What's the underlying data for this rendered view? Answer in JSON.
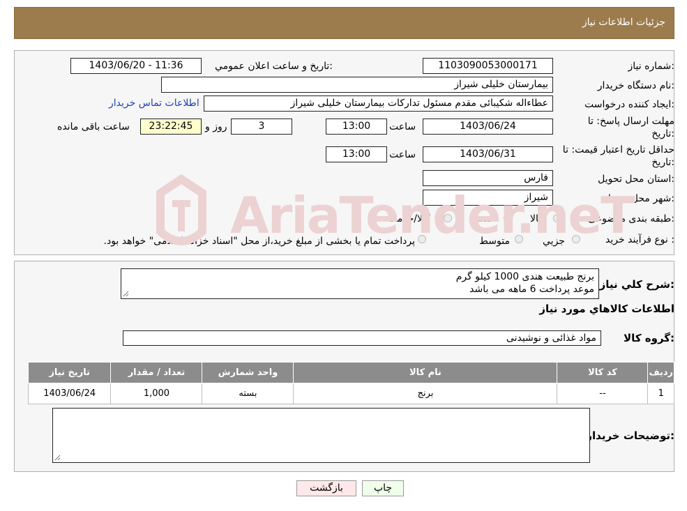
{
  "header": {
    "title": "جزئیات اطلاعات نیاز"
  },
  "form": {
    "need_number_label": "شماره نیاز:",
    "need_number": "1103090053000171",
    "announce_label": "تاریخ و ساعت اعلان عمومي:",
    "announce_value": "1403/06/20 - 11:36",
    "buyer_org_label": "نام دستگاه خریدار:",
    "buyer_org": "بیمارستان خلیلی شیراز",
    "creator_label": "ایجاد کننده درخواست:",
    "creator": "عطاءاله شکیبائی مقدم مسئول تدارکات  بیمارستان خلیلی شیراز",
    "contact_link": "اطلاعات تماس خریدار",
    "deadline_label_1": "مهلت ارسال پاسخ: تا",
    "deadline_label_2": "تاریخ:",
    "deadline_date": "1403/06/24",
    "time_label": "ساعت",
    "deadline_time": "13:00",
    "days": "3",
    "days_label": "روز و",
    "remaining": "23:22:45",
    "remaining_label": "ساعت باقی مانده",
    "validity_label_1": "حداقل تاریخ اعتبار قیمت: تا",
    "validity_label_2": "تاریخ:",
    "validity_date": "1403/06/31",
    "validity_time": "13:00",
    "province_label": "استان محل تحویل:",
    "province": "فارس",
    "city_label": "شهر محل تحویل:",
    "city": "شیراز",
    "category_label": "طبقه بندی موضوعی:",
    "category_options": [
      "کالا",
      "خدمت",
      "کالا/خدمت"
    ],
    "process_label": "نوع فرآیند خرید :",
    "process_options": [
      "جزیي",
      "متوسط"
    ],
    "process_note": "پرداخت تمام یا بخشی از مبلغ خرید،از محل \"اسناد خزانه اسلامی\" خواهد بود."
  },
  "description": {
    "label": "شرح کلي نياز:",
    "line1": "برنج طبیعت هندی  1000 کیلو گرم",
    "line2": "موعد پرداخت 6 ماهه می باشد"
  },
  "goods": {
    "section_title": "اطلاعات کالاهاي مورد نياز",
    "group_label": "گروه کالا:",
    "group_value": "مواد غذائی و نوشیدنی",
    "columns": [
      "رديف",
      "کد کالا",
      "نام کالا",
      "واحد شمارش",
      "تعداد / مقدار",
      "تاريخ نياز"
    ],
    "rows": [
      [
        "1",
        "--",
        "برنج",
        "بسته",
        "1,000",
        "1403/06/24"
      ]
    ]
  },
  "buyer_notes": {
    "label": "توضیحات خریدار:"
  },
  "buttons": {
    "print": "چاپ",
    "back": "بازگشت"
  },
  "watermark": {
    "text": "AriaTender.neT"
  },
  "colors": {
    "header": "#9c7c4d",
    "link": "#1f3fb8",
    "table_header": "#8c8c8c"
  }
}
